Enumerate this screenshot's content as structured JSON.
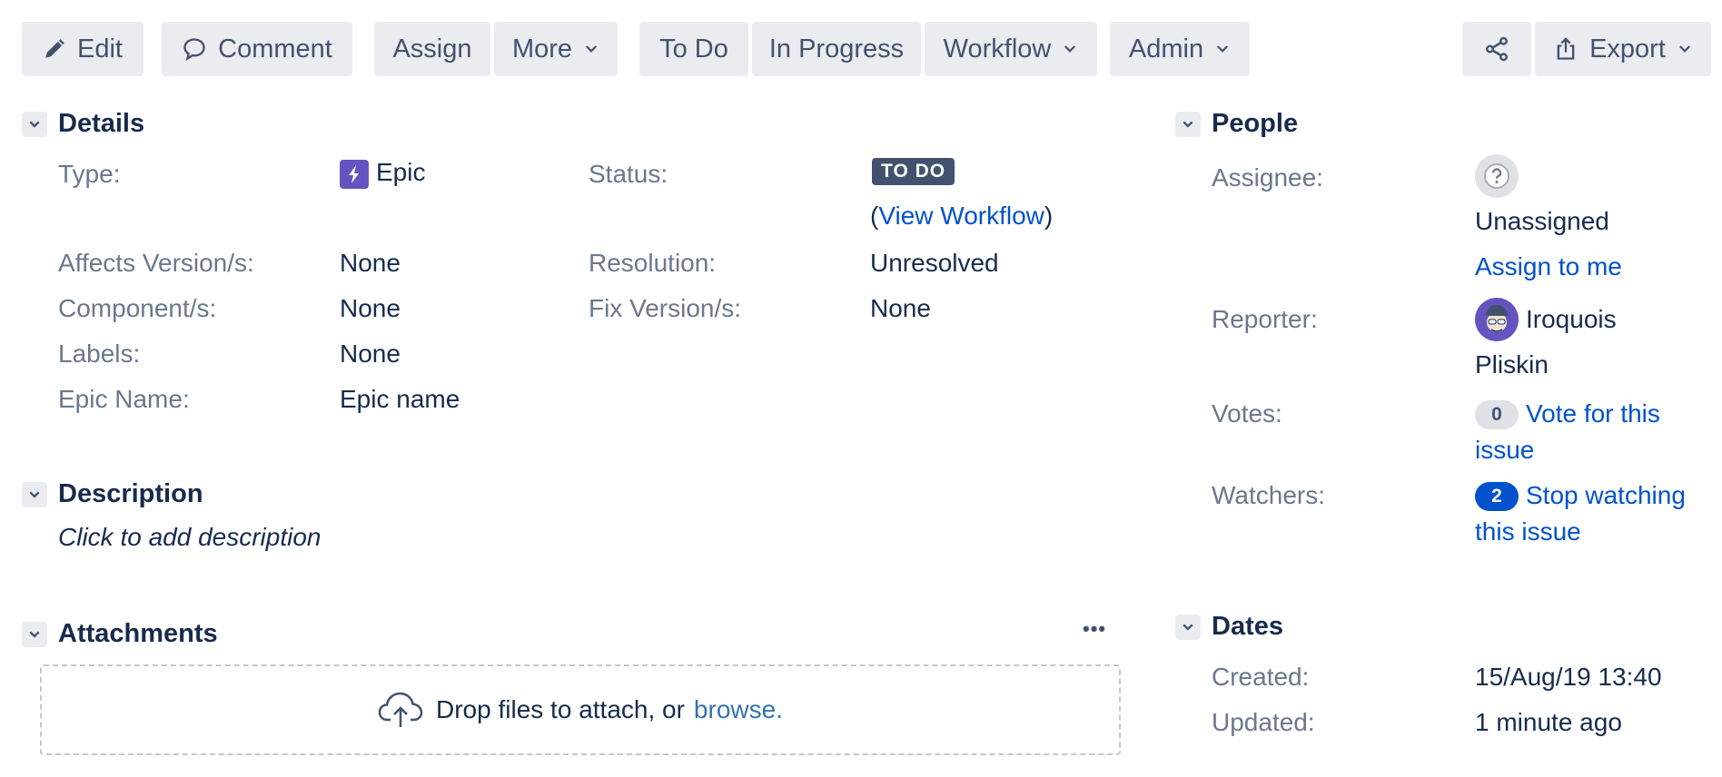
{
  "toolbar": {
    "edit": "Edit",
    "comment": "Comment",
    "assign": "Assign",
    "more": "More",
    "todo": "To Do",
    "in_progress": "In Progress",
    "workflow": "Workflow",
    "admin": "Admin",
    "export": "Export"
  },
  "details": {
    "title": "Details",
    "type_label": "Type:",
    "type_value": "Epic",
    "status_label": "Status:",
    "status_value": "TO DO",
    "view_workflow_open": "(",
    "view_workflow": "View Workflow",
    "view_workflow_close": ")",
    "affects_label": "Affects Version/s:",
    "affects_value": "None",
    "resolution_label": "Resolution:",
    "resolution_value": "Unresolved",
    "components_label": "Component/s:",
    "components_value": "None",
    "fix_label": "Fix Version/s:",
    "fix_value": "None",
    "labels_label": "Labels:",
    "labels_value": "None",
    "epic_name_label": "Epic Name:",
    "epic_name_value": "Epic name"
  },
  "description": {
    "title": "Description",
    "placeholder": "Click to add description"
  },
  "attachments": {
    "title": "Attachments",
    "more": "•••",
    "drop_text": "Drop files to attach, or",
    "browse": "browse."
  },
  "people": {
    "title": "People",
    "assignee_label": "Assignee:",
    "assignee_value": "Unassigned",
    "assign_to_me": "Assign to me",
    "reporter_label": "Reporter:",
    "reporter_first": "Iroquois",
    "reporter_last": "Pliskin",
    "votes_label": "Votes:",
    "votes_count": "0",
    "vote_line1": "Vote for this",
    "vote_line2": "issue",
    "watchers_label": "Watchers:",
    "watchers_count": "2",
    "watch_line1": "Stop watching",
    "watch_line2": "this issue"
  },
  "dates": {
    "title": "Dates",
    "created_label": "Created:",
    "created_value": "15/Aug/19 13:40",
    "updated_label": "Updated:",
    "updated_value": "1 minute ago"
  },
  "colors": {
    "link": "#0052cc",
    "epic": "#6554c0",
    "button_bg": "#ebecf0"
  }
}
